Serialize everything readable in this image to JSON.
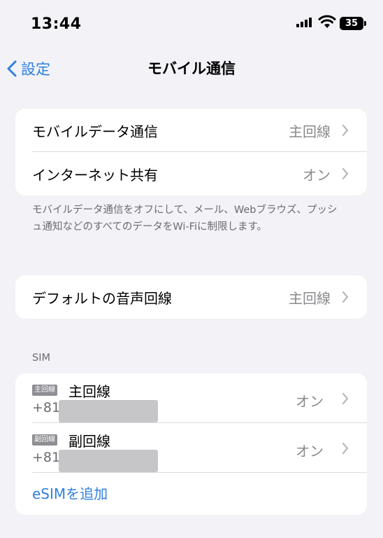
{
  "status_bar": {
    "time": "13:44",
    "battery": "35"
  },
  "nav": {
    "back_label": "設定",
    "title": "モバイル通信"
  },
  "data_group": {
    "rows": [
      {
        "label": "モバイルデータ通信",
        "value": "主回線"
      },
      {
        "label": "インターネット共有",
        "value": "オン"
      }
    ],
    "footer": "モバイルデータ通信をオフにして、メール、Webブラウズ、プッシュ通知などのすべてのデータをWi-Fiに制限します。"
  },
  "default_line": {
    "label": "デフォルトの音声回線",
    "value": "主回線"
  },
  "sim_section": {
    "header": "SIM",
    "lines": [
      {
        "badge": "主回線",
        "name": "主回線",
        "number_prefix": "+81",
        "status": "オン"
      },
      {
        "badge": "副回線",
        "name": "副回線",
        "number_prefix": "+81",
        "status": "オン"
      }
    ],
    "add_esim": "eSIMを追加"
  },
  "colors": {
    "accent": "#2f7fe0",
    "background": "#f2f2f7",
    "secondary_text": "#8a8a8e"
  }
}
